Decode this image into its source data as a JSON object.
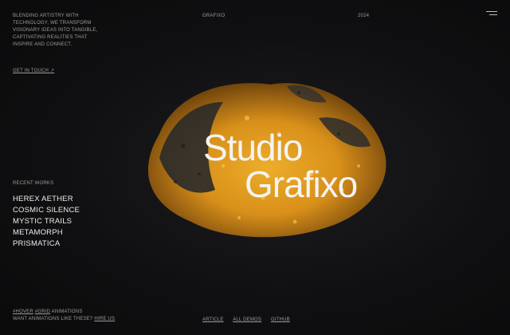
{
  "header": {
    "intro": "BLENDING ARTISTRY WITH TECHNOLOGY, WE TRANSFORM VISIONARY IDEAS INTO TANGIBLE, CAPTIVATING REALITIES THAT INSPIRE AND CONNECT.",
    "contact_label": "GET IN TOUCH ↗",
    "brand": "GRAFIXO",
    "year": "2024",
    "menu_icon": "hamburger-icon"
  },
  "hero": {
    "title_line1": "Studio",
    "title_line2": "Grafixo",
    "colors": {
      "accent": "#f5a623",
      "dark": "#2a2a2a",
      "background": "#0f0f11"
    }
  },
  "works": {
    "label": "RECENT WORKS",
    "items": [
      "HEREX AETHER",
      "COSMIC SILENCE",
      "MYSTIC TRAILS",
      "METAMORPH",
      "PRISMATICA"
    ]
  },
  "footer": {
    "tag_hover": "#HOVER",
    "tag_grid": "#GRID",
    "tags_suffix": " ANIMATIONS",
    "hire_prefix": "WANT ANIMATIONS LIKE THESE? ",
    "hire_label": "HIRE US",
    "links": [
      "ARTICLE",
      "ALL DEMOS",
      "GITHUB"
    ]
  }
}
